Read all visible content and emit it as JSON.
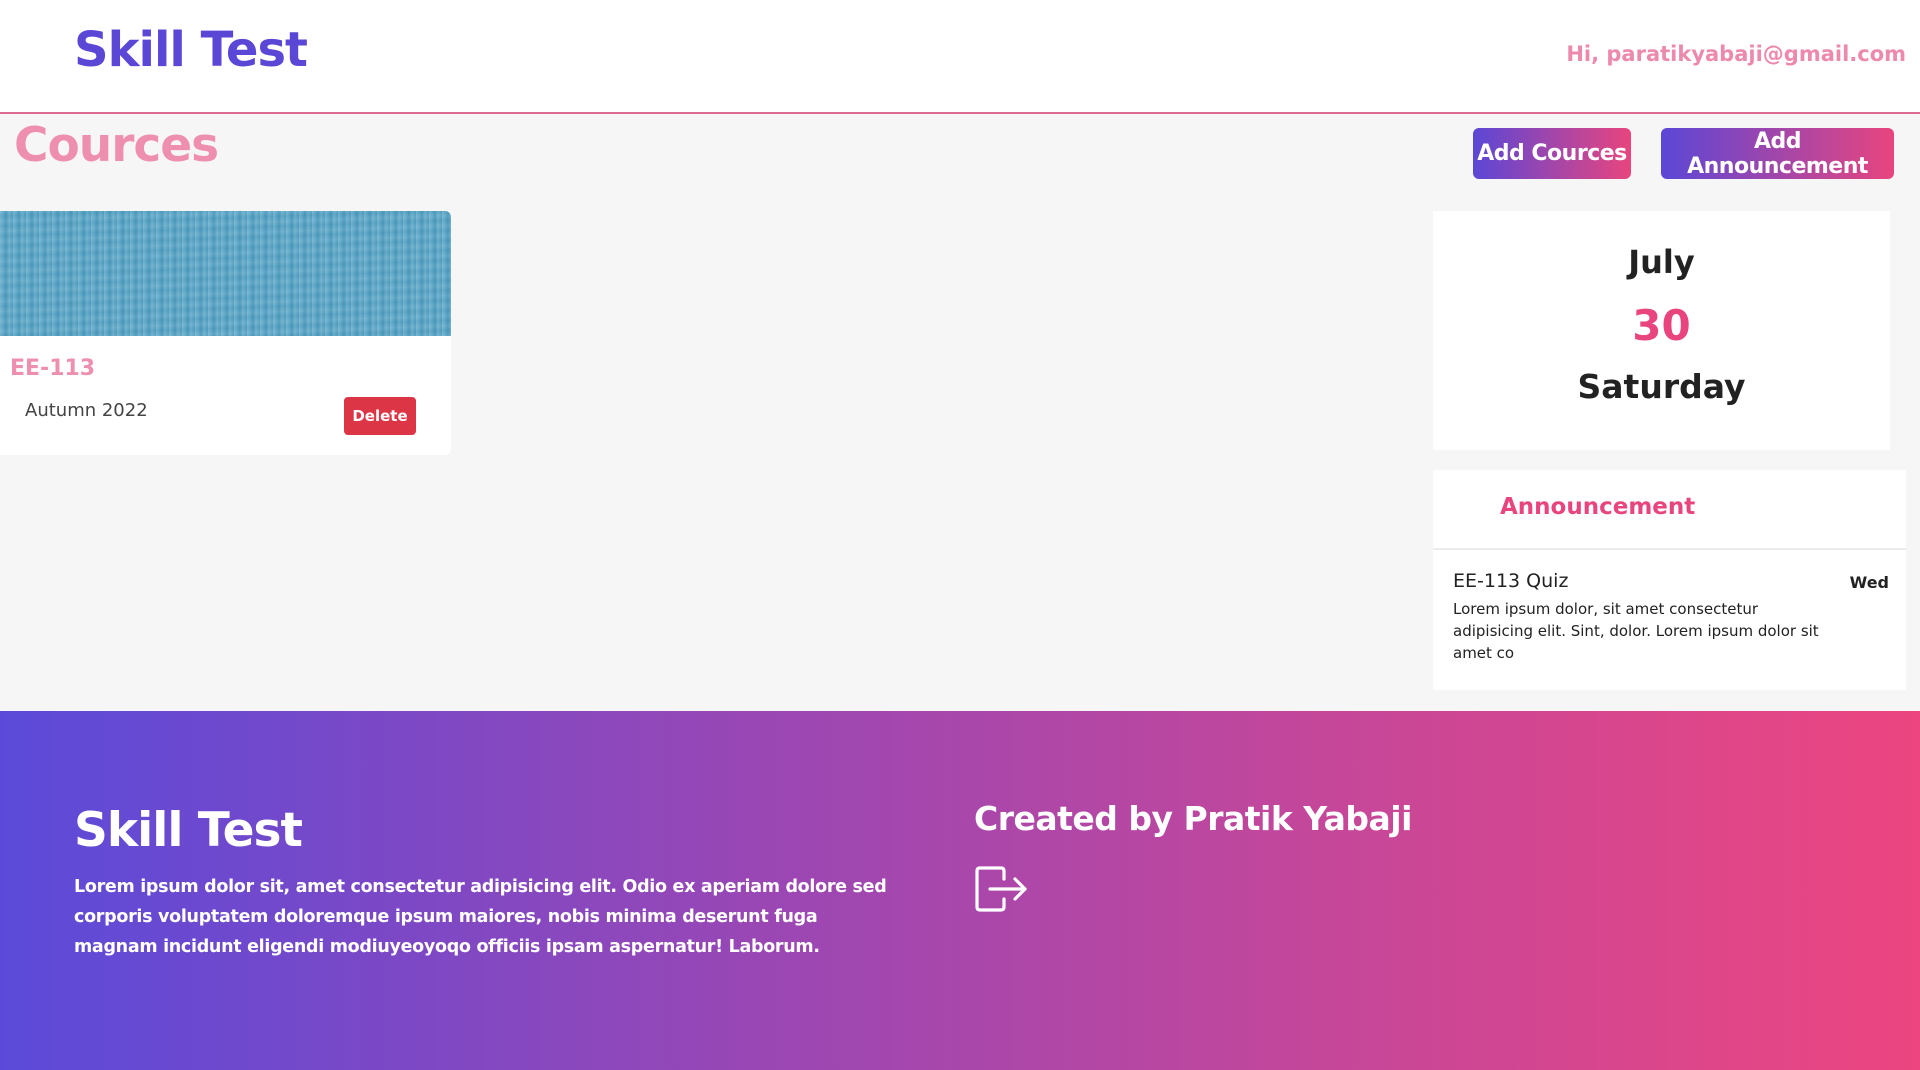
{
  "header": {
    "brand": "Skill Test",
    "greeting": "Hi, paratikyabaji@gmail.com"
  },
  "main": {
    "title": "Cources",
    "add_course_label": "Add Cources",
    "add_announcement_label": "Add Announcement"
  },
  "courses": [
    {
      "code": "EE-113",
      "term": "Autumn 2022",
      "delete_label": "Delete"
    }
  ],
  "date_card": {
    "month": "July",
    "day": "30",
    "weekday": "Saturday"
  },
  "announcements": {
    "title": "Announcement",
    "items": [
      {
        "title": "EE-113 Quiz",
        "day": "Wed",
        "body": "Lorem ipsum dolor, sit amet consectetur adipisicing elit. Sint, dolor. Lorem ipsum dolor sit amet co"
      }
    ]
  },
  "footer": {
    "brand": "Skill Test",
    "description": "Lorem ipsum dolor sit, amet consectetur adipisicing elit. Odio ex aperiam dolore sed corporis voluptatem doloremque ipsum maiores, nobis minima deserunt fuga magnam incidunt eligendi modiuyeoyoqo officiis ipsam aspernatur! Laborum.",
    "credit": "Created by Pratik Yabaji",
    "logout_icon": "logout-icon"
  },
  "colors": {
    "brand_purple": "#5b47d6",
    "brand_pink": "#e8457e",
    "light_pink": "#ee8fb0",
    "danger": "#dc3545"
  }
}
